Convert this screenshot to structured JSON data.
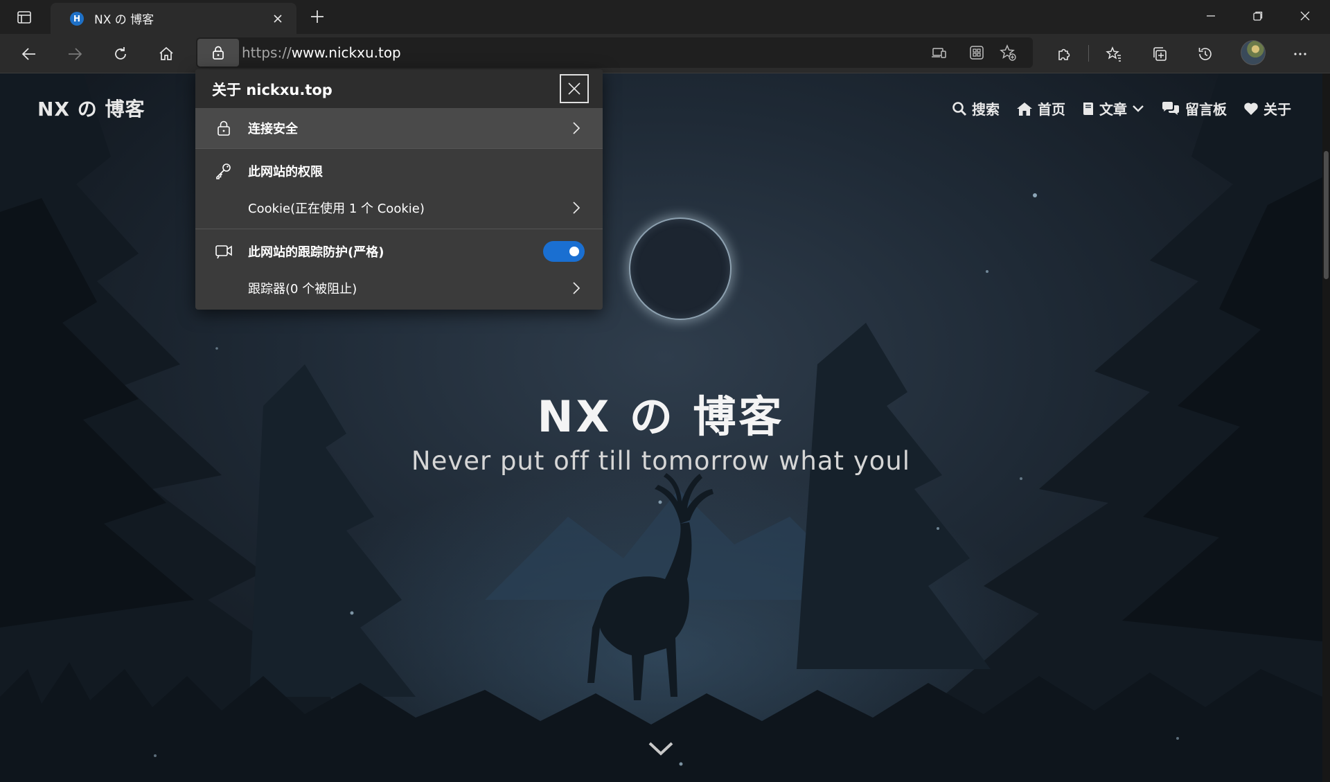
{
  "browser": {
    "tab": {
      "title": "NX の 博客",
      "favicon_letter": "H"
    },
    "address_bar": {
      "scheme": "https://",
      "host": "www.nickxu.top"
    }
  },
  "site": {
    "logo": "NX の 博客",
    "nav": [
      {
        "label": "搜索",
        "icon": "search-icon"
      },
      {
        "label": "首页",
        "icon": "home-icon"
      },
      {
        "label": "文章",
        "icon": "book-icon",
        "dropdown": true
      },
      {
        "label": "留言板",
        "icon": "comments-icon"
      },
      {
        "label": "关于",
        "icon": "heart-icon"
      }
    ],
    "hero_title": "NX の 博客",
    "hero_subtitle": "Never put off till tomorrow what youl"
  },
  "popup": {
    "title": "关于 nickxu.top",
    "connection": "连接安全",
    "permissions_heading": "此网站的权限",
    "cookies": "Cookie(正在使用 1 个 Cookie)",
    "tracking_heading": "此网站的跟踪防护(严格)",
    "tracking_enabled": true,
    "trackers": "跟踪器(0 个被阻止)"
  },
  "colors": {
    "toggle_on": "#1a6fd1",
    "favicon": "#1e70c6"
  }
}
